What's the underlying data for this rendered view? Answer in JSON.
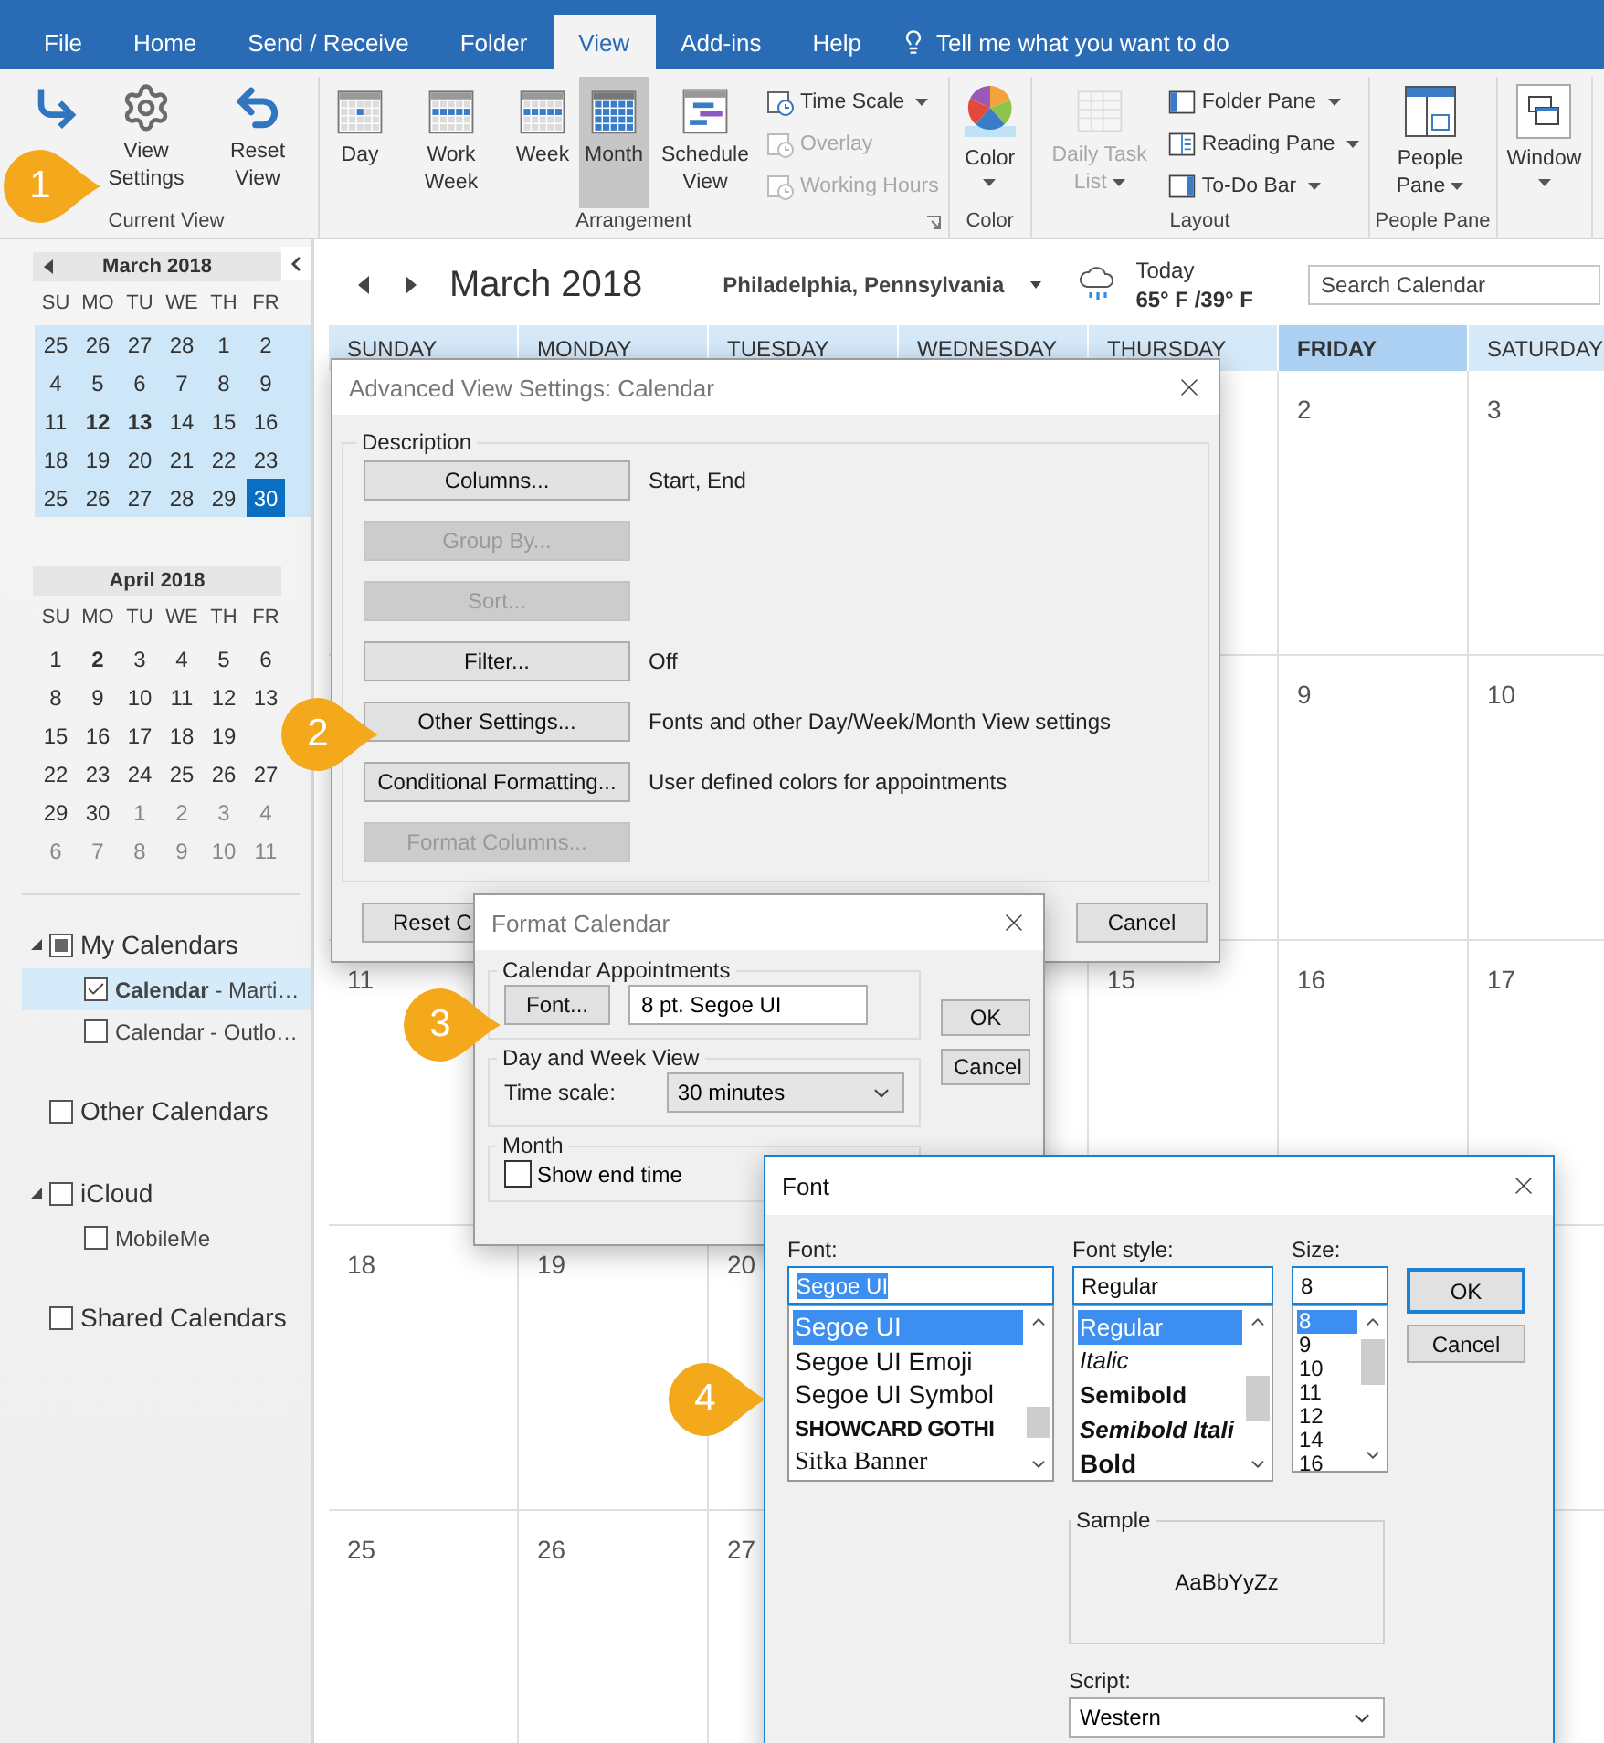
{
  "ribbon_tabs": [
    {
      "label": "File",
      "selected": false
    },
    {
      "label": "Home",
      "selected": false
    },
    {
      "label": "Send / Receive",
      "selected": false
    },
    {
      "label": "Folder",
      "selected": false
    },
    {
      "label": "View",
      "selected": true
    },
    {
      "label": "Add-ins",
      "selected": false
    },
    {
      "label": "Help",
      "selected": false
    }
  ],
  "tell_me": "Tell me what you want to do",
  "ribbon_groups": [
    {
      "label": "Current View",
      "items": [
        {
          "kind": "large",
          "selected": false,
          "disabled": false,
          "dropdown": false
        },
        {
          "kind": "large",
          "label": "View Settings",
          "selected": false,
          "disabled": false,
          "dropdown": false
        },
        {
          "kind": "large",
          "label": "Reset View",
          "selected": false,
          "disabled": false,
          "dropdown": false
        }
      ]
    },
    {
      "label": "Arrangement",
      "launcher": true,
      "items": [
        {
          "kind": "large",
          "label": "Day",
          "selected": false,
          "disabled": false,
          "dropdown": false
        },
        {
          "kind": "large",
          "label": "Work Week",
          "selected": false,
          "disabled": false,
          "dropdown": false
        },
        {
          "kind": "large",
          "label": "Week",
          "selected": false,
          "disabled": false,
          "dropdown": false
        },
        {
          "kind": "large",
          "label": "Month",
          "selected": true,
          "disabled": false,
          "dropdown": false
        },
        {
          "kind": "large",
          "label": "Schedule View",
          "selected": false,
          "disabled": false,
          "dropdown": false
        },
        {
          "kind": "stack",
          "items": [
            {
              "label": "Time Scale",
              "disabled": false,
              "dropdown": true
            },
            {
              "label": "Overlay",
              "disabled": true,
              "dropdown": false
            },
            {
              "label": "Working Hours",
              "disabled": true,
              "dropdown": false
            }
          ]
        }
      ]
    },
    {
      "label": "Color",
      "items": [
        {
          "kind": "menu",
          "label": "Color",
          "selected": false,
          "disabled": false,
          "dropdown": true
        }
      ]
    },
    {
      "label": "Layout",
      "items": [
        {
          "kind": "large",
          "label": "Daily Task List",
          "selected": false,
          "disabled": true,
          "dropdown": true
        },
        {
          "kind": "stack",
          "items": [
            {
              "label": "Folder Pane",
              "disabled": false,
              "dropdown": true
            },
            {
              "label": "Reading Pane",
              "disabled": false,
              "dropdown": true
            },
            {
              "label": "To-Do Bar",
              "disabled": false,
              "dropdown": true
            }
          ]
        }
      ]
    },
    {
      "label": "People Pane",
      "items": [
        {
          "kind": "large",
          "label": "People Pane",
          "selected": false,
          "disabled": false,
          "dropdown": true
        }
      ]
    },
    {
      "items": [
        {
          "kind": "menu",
          "label": "Window",
          "selected": false,
          "disabled": false,
          "dropdown": true
        }
      ]
    }
  ],
  "sidebar": {
    "mini_calendars": [
      {
        "title": "March 2018",
        "prev_arrow": true,
        "highlighted": true,
        "weekdays": [
          "SU",
          "MO",
          "TU",
          "WE",
          "TH",
          "FR"
        ],
        "weeks": [
          [
            {
              "d": "25",
              "kind": "normal",
              "selected": false
            },
            {
              "d": "26",
              "kind": "normal",
              "selected": false
            },
            {
              "d": "27",
              "kind": "normal",
              "selected": false
            },
            {
              "d": "28",
              "kind": "normal",
              "selected": false
            },
            {
              "d": "1",
              "kind": "normal",
              "selected": false
            },
            {
              "d": "2",
              "kind": "normal",
              "selected": false
            }
          ],
          [
            {
              "d": "4",
              "kind": "normal",
              "selected": false
            },
            {
              "d": "5",
              "kind": "normal",
              "selected": false
            },
            {
              "d": "6",
              "kind": "normal",
              "selected": false
            },
            {
              "d": "7",
              "kind": "normal",
              "selected": false
            },
            {
              "d": "8",
              "kind": "normal",
              "selected": false
            },
            {
              "d": "9",
              "kind": "normal",
              "selected": false
            }
          ],
          [
            {
              "d": "11",
              "kind": "normal",
              "selected": false
            },
            {
              "d": "12",
              "kind": "bold",
              "selected": false
            },
            {
              "d": "13",
              "kind": "bold",
              "selected": false
            },
            {
              "d": "14",
              "kind": "normal",
              "selected": false
            },
            {
              "d": "15",
              "kind": "normal",
              "selected": false
            },
            {
              "d": "16",
              "kind": "normal",
              "selected": false
            }
          ],
          [
            {
              "d": "18",
              "kind": "normal",
              "selected": false
            },
            {
              "d": "19",
              "kind": "normal",
              "selected": false
            },
            {
              "d": "20",
              "kind": "normal",
              "selected": false
            },
            {
              "d": "21",
              "kind": "normal",
              "selected": false
            },
            {
              "d": "22",
              "kind": "normal",
              "selected": false
            },
            {
              "d": "23",
              "kind": "normal",
              "selected": false
            }
          ],
          [
            {
              "d": "25",
              "kind": "normal",
              "selected": false
            },
            {
              "d": "26",
              "kind": "normal",
              "selected": false
            },
            {
              "d": "27",
              "kind": "normal",
              "selected": false
            },
            {
              "d": "28",
              "kind": "normal",
              "selected": false
            },
            {
              "d": "29",
              "kind": "normal",
              "selected": false
            },
            {
              "d": "30",
              "kind": "normal",
              "selected": true
            }
          ]
        ]
      },
      {
        "title": "April 2018",
        "prev_arrow": false,
        "highlighted": false,
        "weekdays": [
          "SU",
          "MO",
          "TU",
          "WE",
          "TH",
          "FR"
        ],
        "weeks": [
          [
            {
              "d": "1",
              "kind": "normal",
              "selected": false
            },
            {
              "d": "2",
              "kind": "bold",
              "selected": false
            },
            {
              "d": "3",
              "kind": "normal",
              "selected": false
            },
            {
              "d": "4",
              "kind": "normal",
              "selected": false
            },
            {
              "d": "5",
              "kind": "normal",
              "selected": false
            },
            {
              "d": "6",
              "kind": "normal",
              "selected": false
            }
          ],
          [
            {
              "d": "8",
              "kind": "normal",
              "selected": false
            },
            {
              "d": "9",
              "kind": "normal",
              "selected": false
            },
            {
              "d": "10",
              "kind": "normal",
              "selected": false
            },
            {
              "d": "11",
              "kind": "normal",
              "selected": false
            },
            {
              "d": "12",
              "kind": "normal",
              "selected": false
            },
            {
              "d": "13",
              "kind": "normal",
              "selected": false
            }
          ],
          [
            {
              "d": "15",
              "kind": "normal",
              "selected": false
            },
            {
              "d": "16",
              "kind": "normal",
              "selected": false
            },
            {
              "d": "17",
              "kind": "normal",
              "selected": false
            },
            {
              "d": "18",
              "kind": "normal",
              "selected": false
            },
            {
              "d": "19",
              "kind": "normal",
              "selected": false
            }
          ],
          [
            {
              "d": "22",
              "kind": "normal",
              "selected": false
            },
            {
              "d": "23",
              "kind": "normal",
              "selected": false
            },
            {
              "d": "24",
              "kind": "normal",
              "selected": false
            },
            {
              "d": "25",
              "kind": "normal",
              "selected": false
            },
            {
              "d": "26",
              "kind": "normal",
              "selected": false
            },
            {
              "d": "27",
              "kind": "normal",
              "selected": false
            }
          ],
          [
            {
              "d": "29",
              "kind": "normal",
              "selected": false
            },
            {
              "d": "30",
              "kind": "normal",
              "selected": false
            },
            {
              "d": "1",
              "kind": "muted",
              "selected": false
            },
            {
              "d": "2",
              "kind": "muted",
              "selected": false
            },
            {
              "d": "3",
              "kind": "muted",
              "selected": false
            },
            {
              "d": "4",
              "kind": "muted",
              "selected": false
            }
          ],
          [
            {
              "d": "6",
              "kind": "muted",
              "selected": false
            },
            {
              "d": "7",
              "kind": "muted",
              "selected": false
            },
            {
              "d": "8",
              "kind": "muted",
              "selected": false
            },
            {
              "d": "9",
              "kind": "muted",
              "selected": false
            },
            {
              "d": "10",
              "kind": "muted",
              "selected": false
            },
            {
              "d": "11",
              "kind": "muted",
              "selected": false
            }
          ]
        ]
      }
    ],
    "folders": [
      {
        "label": "My Calendars",
        "checked": false,
        "partial": true,
        "expanded": true,
        "children": [
          {
            "label": "**Calendar** - Marti…",
            "checked": true,
            "selected": true
          },
          {
            "label": "Calendar - Outlo…",
            "checked": false,
            "partial": false,
            "selected": false
          }
        ]
      },
      {
        "label": "Other Calendars",
        "checked": false,
        "partial": false
      },
      {
        "label": "iCloud",
        "checked": false,
        "partial": false,
        "expanded": true,
        "children": [
          {
            "label": "MobileMe",
            "checked": false,
            "partial": false,
            "selected": false
          }
        ]
      },
      {
        "label": "Shared Calendars",
        "checked": false,
        "partial": false
      }
    ]
  },
  "calendar": {
    "title": "March 2018",
    "location": "Philadelphia, Pennsylvania",
    "weather": {
      "label": "Today",
      "temps": "65° F /39° F"
    },
    "search": {
      "placeholder": "Search Calendar"
    },
    "days": [
      {
        "label": "SUNDAY",
        "today": false
      },
      {
        "label": "MONDAY",
        "today": false
      },
      {
        "label": "TUESDAY",
        "today": false
      },
      {
        "label": "WEDNESDAY",
        "today": false
      },
      {
        "label": "THURSDAY",
        "today": false
      },
      {
        "label": "FRIDAY",
        "today": true
      },
      {
        "label": "SATURDAY",
        "today": false
      }
    ],
    "weeks": [
      {
        "friday": "2",
        "saturday": "3"
      },
      {
        "friday": "9",
        "saturday": "10"
      },
      {
        "sunday": "11",
        "thursday": "15",
        "friday": "16",
        "saturday": "17"
      },
      {
        "sunday": "18",
        "monday": "19",
        "tuesday": "20"
      },
      {
        "sunday": "25",
        "monday": "26",
        "tuesday": "27"
      }
    ]
  },
  "advanced_dialog": {
    "title": "Advanced View Settings: Calendar",
    "group": "Description",
    "rows": [
      {
        "button": "Columns...",
        "disabled": false,
        "value": "Start, End"
      },
      {
        "button": "Group By...",
        "disabled": true
      },
      {
        "button": "Sort...",
        "disabled": true
      },
      {
        "button": "Filter...",
        "disabled": false,
        "value": "Off"
      },
      {
        "button": "Other Settings...",
        "disabled": false,
        "value": "Fonts and other Day/Week/Month View settings"
      },
      {
        "button": "Conditional Formatting...",
        "disabled": false,
        "value": "User defined colors for appointments"
      },
      {
        "button": "Format Columns...",
        "disabled": true
      }
    ],
    "buttons": [
      "Reset C",
      "Cancel"
    ]
  },
  "format_dialog": {
    "title": "Format Calendar",
    "groups": [
      {
        "label": "Calendar Appointments",
        "kind": "font",
        "button": "Font...",
        "value": "8 pt. Segoe UI"
      },
      {
        "label": "Day and Week View",
        "kind": "select",
        "field_label": "Time scale:",
        "value": "30 minutes"
      },
      {
        "label": "Month",
        "kind": "checkbox",
        "checkbox": "Show end time",
        "checked": false
      }
    ],
    "buttons": [
      "OK",
      "Cancel"
    ]
  },
  "font_dialog": {
    "title": "Font",
    "columns": [
      {
        "label": "Font:",
        "value": "Segoe UI",
        "highlighted": true,
        "items": [
          {
            "text": "Segoe UI",
            "kind": "sans",
            "selected": true
          },
          {
            "text": "Segoe UI Emoji",
            "kind": "sans",
            "selected": false
          },
          {
            "text": "Segoe UI Symbol",
            "kind": "sans",
            "selected": false
          },
          {
            "text": "SHOWCARD GOTHI",
            "kind": "display",
            "selected": false
          },
          {
            "text": "Sitka Banner",
            "kind": "serif",
            "selected": false
          }
        ]
      },
      {
        "label": "Font style:",
        "value": "Regular",
        "highlighted": false,
        "items": [
          {
            "text": "Regular",
            "kind": "regular",
            "selected": true
          },
          {
            "text": "Italic",
            "kind": "italic",
            "selected": false
          },
          {
            "text": "Semibold",
            "kind": "semibold",
            "selected": false
          },
          {
            "text": "Semibold Itali",
            "kind": "semibolditalic",
            "selected": false
          },
          {
            "text": "Bold",
            "kind": "bold",
            "selected": false
          }
        ]
      },
      {
        "label": "Size:",
        "value": "8",
        "highlighted": false,
        "items": [
          {
            "text": "8",
            "kind": "size",
            "selected": true
          },
          {
            "text": "9",
            "kind": "size",
            "selected": false
          },
          {
            "text": "10",
            "kind": "size",
            "selected": false
          },
          {
            "text": "11",
            "kind": "size",
            "selected": false
          },
          {
            "text": "12",
            "kind": "size",
            "selected": false
          },
          {
            "text": "14",
            "kind": "size",
            "selected": false
          },
          {
            "text": "16",
            "kind": "size",
            "selected": false
          }
        ]
      }
    ],
    "buttons": [
      {
        "label": "OK",
        "default": true
      },
      {
        "label": "Cancel",
        "default": false
      }
    ],
    "sample": {
      "label": "Sample",
      "text": "AaBbYyZz"
    },
    "script": {
      "label": "Script:",
      "value": "Western"
    }
  },
  "callouts": [
    "1",
    "2",
    "3",
    "4"
  ]
}
